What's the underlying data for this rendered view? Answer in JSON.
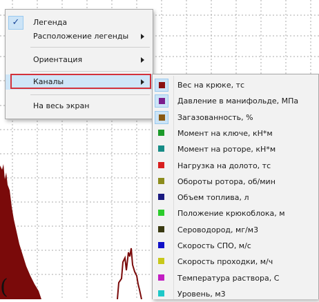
{
  "menu": {
    "items": [
      {
        "label": "Легенда",
        "checked": true,
        "submenu": false
      },
      {
        "label": "Расположение легенды",
        "checked": false,
        "submenu": true
      },
      {
        "label": "Ориентация",
        "checked": false,
        "submenu": true
      },
      {
        "label": "Каналы",
        "checked": false,
        "submenu": true,
        "active": true
      },
      {
        "label": "На весь экран",
        "checked": false,
        "submenu": false
      }
    ],
    "check_glyph": "✓"
  },
  "channels": [
    {
      "label": "Вес на крюке, тс",
      "color": "#8b1010",
      "checked": true
    },
    {
      "label": "Давление в манифольде, МПа",
      "color": "#7a1e8c",
      "checked": true
    },
    {
      "label": "Загазованность, %",
      "color": "#8a5a14",
      "checked": true
    },
    {
      "label": "Момент на ключе, кН*м",
      "color": "#1c9a2a",
      "checked": false
    },
    {
      "label": "Момент на роторе, кН*м",
      "color": "#178c86",
      "checked": false
    },
    {
      "label": "Нагрузка на долото, тс",
      "color": "#d81e1e",
      "checked": false
    },
    {
      "label": "Обороты ротора, об/мин",
      "color": "#8c8c1c",
      "checked": false
    },
    {
      "label": "Объем топлива, л",
      "color": "#1a1a80",
      "checked": false
    },
    {
      "label": "Положение крюкоблока, м",
      "color": "#2ccc2c",
      "checked": false
    },
    {
      "label": "Сероводород, мг/м3",
      "color": "#3a3a12",
      "checked": false
    },
    {
      "label": "Скорость СПО, м/с",
      "color": "#1010c8",
      "checked": false
    },
    {
      "label": "Скорость проходки, м/ч",
      "color": "#c8c81a",
      "checked": false
    },
    {
      "label": "Температура раствора, С",
      "color": "#c21ec2",
      "checked": false
    },
    {
      "label": "Уровень, м3",
      "color": "#1ec8c8",
      "checked": false
    }
  ],
  "background": {
    "stray_text": "(",
    "series_color": "#7a0a0a"
  }
}
